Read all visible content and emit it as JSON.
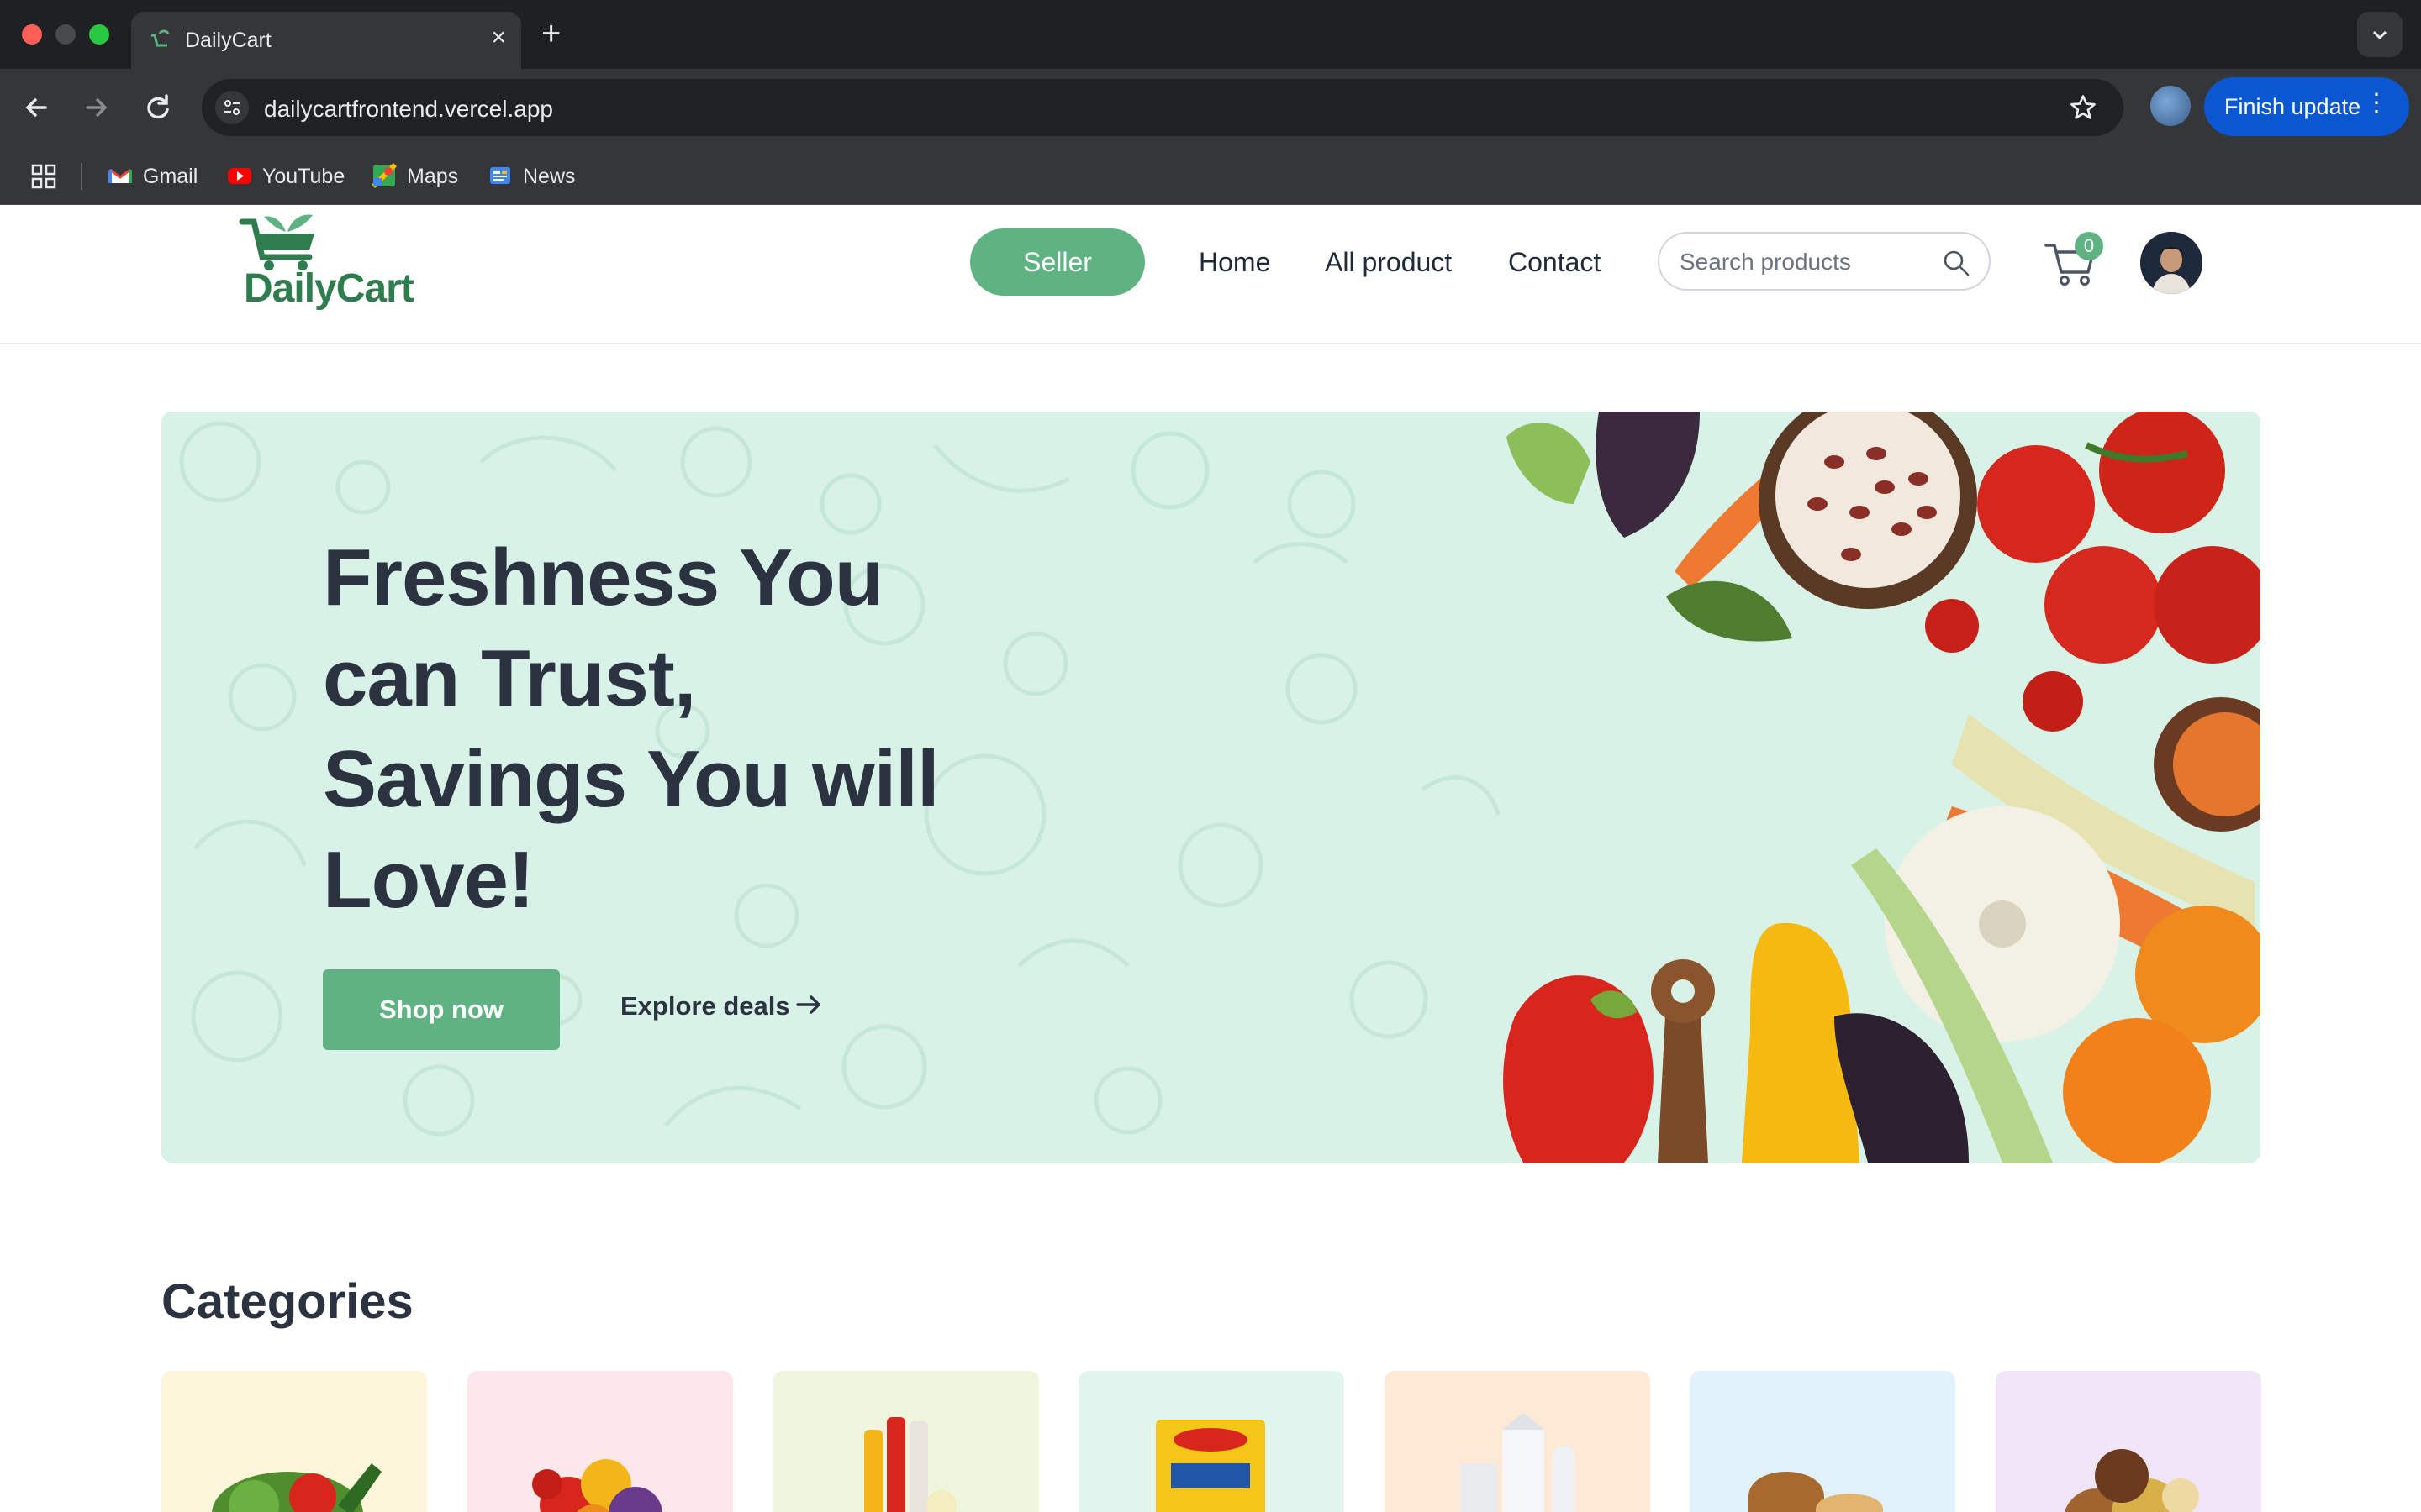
{
  "browser": {
    "tab_title": "DailyCart",
    "url": "dailycartfrontend.vercel.app",
    "update_label": "Finish update",
    "bookmarks": [
      {
        "label": "Gmail",
        "icon": "gmail-icon",
        "color": "#ea4335"
      },
      {
        "label": "YouTube",
        "icon": "youtube-icon",
        "color": "#ff0000"
      },
      {
        "label": "Maps",
        "icon": "maps-icon",
        "color": "#34a853"
      },
      {
        "label": "News",
        "icon": "news-icon",
        "color": "#4285f4"
      }
    ]
  },
  "header": {
    "logo_text": "DailyCart",
    "seller_label": "Seller",
    "nav": [
      "Home",
      "All product",
      "Contact"
    ],
    "search_placeholder": "Search products",
    "cart_count": "0"
  },
  "hero": {
    "title": "Freshness You can Trust, Savings You will Love!",
    "shop_label": "Shop now",
    "explore_label": "Explore deals"
  },
  "categories": {
    "title": "Categories",
    "cards": [
      {
        "name": "vegetables",
        "bg": "#fef6da"
      },
      {
        "name": "fruits",
        "bg": "#fce7ea"
      },
      {
        "name": "drinks",
        "bg": "#f0f5dd"
      },
      {
        "name": "instant-food",
        "bg": "#e1f5ee"
      },
      {
        "name": "dairy",
        "bg": "#fde9d6"
      },
      {
        "name": "bakery",
        "bg": "#e2f2fc"
      },
      {
        "name": "grains",
        "bg": "#f0e4f7"
      }
    ]
  },
  "colors": {
    "brand_green": "#5fb383",
    "hero_bg": "#d9f2e7",
    "text_dark": "#2b3340"
  }
}
